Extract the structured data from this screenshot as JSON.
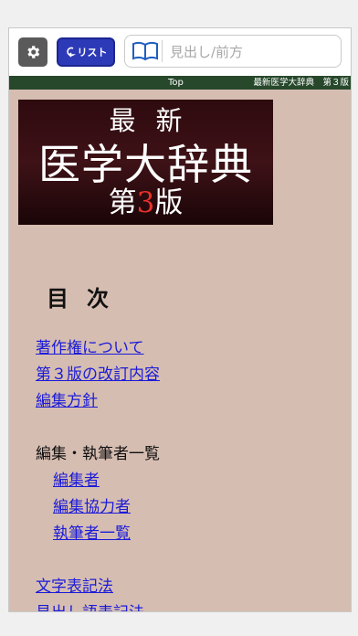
{
  "toolbar": {
    "gear_icon": "gear-icon",
    "list_button_label": "リスト",
    "search_placeholder": "見出し/前方"
  },
  "navbar": {
    "top_link": "Top",
    "title": "最新医学大辞典　第３版"
  },
  "banner": {
    "line1": "最新",
    "line2": "医学大辞典",
    "line3_prefix": "第",
    "line3_number": "3",
    "line3_suffix": "版"
  },
  "toc": {
    "heading": "目次",
    "links_a": [
      "著作権について",
      "第３版の改訂内容",
      "編集方針"
    ],
    "editors_label": "編集・執筆者一覧",
    "links_b": [
      "編集者",
      "編集協力者",
      "執筆者一覧"
    ],
    "links_c": [
      "文字表記法",
      "見出し語表記法"
    ]
  },
  "colors": {
    "page_background": "#d6bdb1",
    "navbar": "#27482b",
    "list_button": "#2d3ab8",
    "link": "#1b1bd9",
    "banner_red": "#e8302a"
  }
}
